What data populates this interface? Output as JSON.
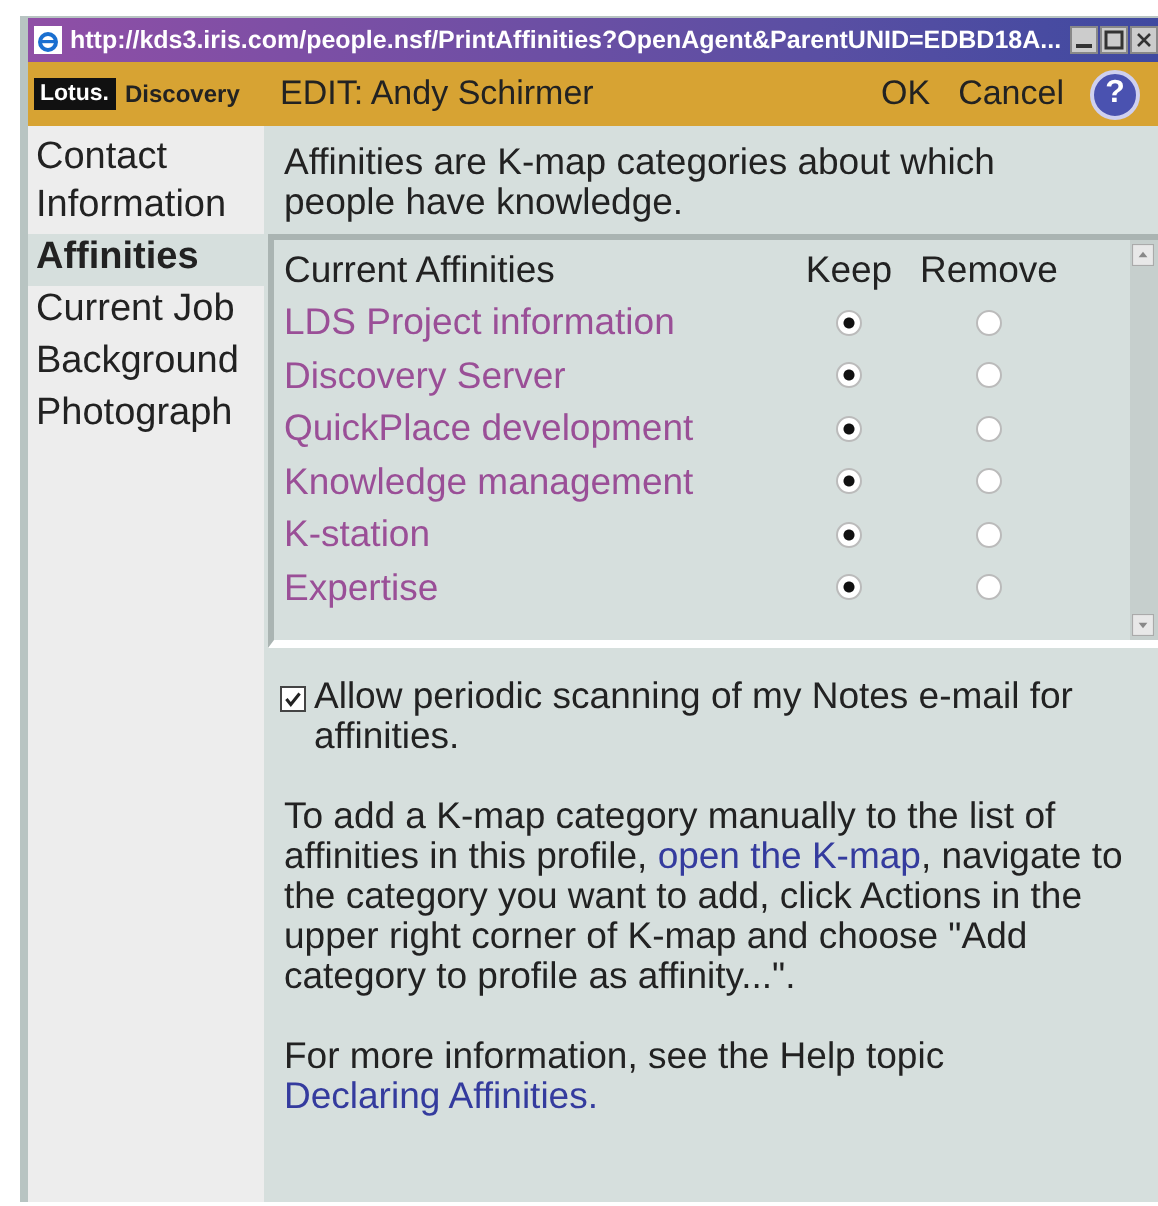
{
  "window": {
    "title": "http://kds3.iris.com/people.nsf/PrintAffinities?OpenAgent&ParentUNID=EDBD18A..."
  },
  "header": {
    "logo": "Lotus.",
    "product": "Discovery",
    "title": "EDIT: Andy Schirmer",
    "buttons": [
      "OK",
      "Cancel"
    ],
    "help": "?"
  },
  "sidebar": {
    "items": [
      {
        "label": "Contact Information",
        "selected": false
      },
      {
        "label": "Affinities",
        "selected": true
      },
      {
        "label": "Current Job",
        "selected": false
      },
      {
        "label": "Background",
        "selected": false
      },
      {
        "label": "Photograph",
        "selected": false
      }
    ]
  },
  "intro": "Affinities are K-map categories about which people have knowledge.",
  "table": {
    "columns": [
      "Current Affinities",
      "Keep",
      "Remove"
    ],
    "rows": [
      {
        "name": "LDS Project information",
        "keep": true,
        "remove": false
      },
      {
        "name": "Discovery Server",
        "keep": true,
        "remove": false
      },
      {
        "name": "QuickPlace development",
        "keep": true,
        "remove": false
      },
      {
        "name": "Knowledge management",
        "keep": true,
        "remove": false
      },
      {
        "name": "K-station",
        "keep": true,
        "remove": false
      },
      {
        "name": "Expertise",
        "keep": true,
        "remove": false
      }
    ]
  },
  "scan_option": {
    "label": "Allow periodic scanning of my Notes e-mail for affinities.",
    "checked": true
  },
  "manual_text": {
    "before": "To add a K-map category manually to the list of affinities in this profile, ",
    "link": "open the K-map",
    "after": ", navigate to the category you want to add, click Actions in the upper right corner of K-map and choose \"Add category to profile as affinity...\"."
  },
  "help_text": {
    "text": "For more information, see the Help topic",
    "link": "Declaring Affinities."
  }
}
